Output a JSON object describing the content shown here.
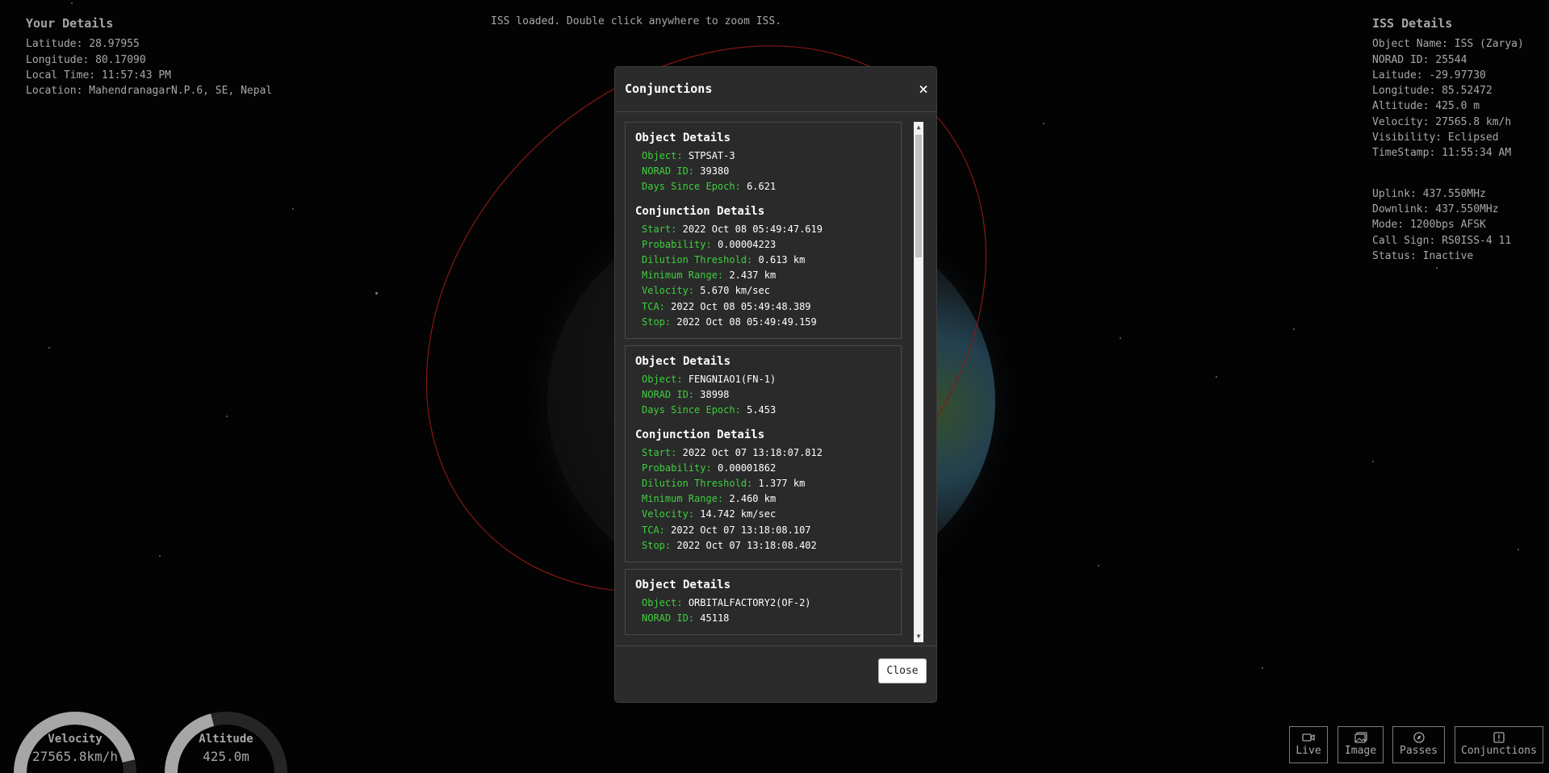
{
  "status_message": "ISS loaded. Double click anywhere to zoom ISS.",
  "your_details": {
    "title": "Your Details",
    "latitude": "Latitude: 28.97955",
    "longitude": "Longitude: 80.17090",
    "local_time": "Local Time: 11:57:43 PM",
    "location": "Location: MahendranagarN.P.6, SE, Nepal"
  },
  "iss_details": {
    "title": "ISS Details",
    "object_name": "Object Name: ISS (Zarya)",
    "norad_id": "NORAD ID: 25544",
    "latitude": "Laitude: -29.97730",
    "longitude": "Longitude: 85.52472",
    "altitude": "Altitude: 425.0 m",
    "velocity": "Velocity: 27565.8 km/h",
    "visibility": "Visibility: Eclipsed",
    "timestamp": "TimeStamp: 11:55:34 AM",
    "uplink": "Uplink: 437.550MHz",
    "downlink": "Downlink: 437.550MHz",
    "mode": "Mode: 1200bps AFSK",
    "call_sign": "Call Sign: RS0ISS-4 11",
    "status": "Status: Inactive"
  },
  "modal": {
    "title": "Conjunctions",
    "close_x": "×",
    "close_label": "Close",
    "object_heading": "Object Details",
    "conjunction_heading": "Conjunction Details",
    "labels": {
      "object": "Object:",
      "norad": "NORAD ID:",
      "days": "Days Since Epoch:",
      "start": "Start:",
      "probability": "Probability:",
      "dilution": "Dilution Threshold:",
      "min_range": "Minimum Range:",
      "velocity": "Velocity:",
      "tca": "TCA:",
      "stop": "Stop:"
    },
    "items": [
      {
        "object": "STPSAT-3",
        "norad": "39380",
        "days": "6.621",
        "start": "2022 Oct 08 05:49:47.619",
        "probability": "0.00004223",
        "dilution": "0.613 km",
        "min_range": "2.437 km",
        "velocity": "5.670 km/sec",
        "tca": "2022 Oct 08 05:49:48.389",
        "stop": "2022 Oct 08 05:49:49.159"
      },
      {
        "object": "FENGNIAO1(FN-1)",
        "norad": "38998",
        "days": "5.453",
        "start": "2022 Oct 07 13:18:07.812",
        "probability": "0.00001862",
        "dilution": "1.377 km",
        "min_range": "2.460 km",
        "velocity": "14.742 km/sec",
        "tca": "2022 Oct 07 13:18:08.107",
        "stop": "2022 Oct 07 13:18:08.402"
      },
      {
        "object": "ORBITALFACTORY2(OF-2)",
        "norad": "45118"
      }
    ]
  },
  "gauges": {
    "velocity": {
      "label": "Velocity",
      "value": "27565.8km/h",
      "fill_fraction": 0.93
    },
    "altitude": {
      "label": "Altitude",
      "value": "425.0m",
      "fill_fraction": 0.42
    }
  },
  "nav": {
    "live": "Live",
    "image": "Image",
    "passes": "Passes",
    "conjunctions": "Conjunctions"
  },
  "colors": {
    "label_green": "#3ecf3e",
    "orbit_red": "#d0261e",
    "modal_bg": "#2b2b2b"
  },
  "icons": [
    "video-camera-icon",
    "image-icon",
    "compass-icon",
    "alert-icon"
  ]
}
